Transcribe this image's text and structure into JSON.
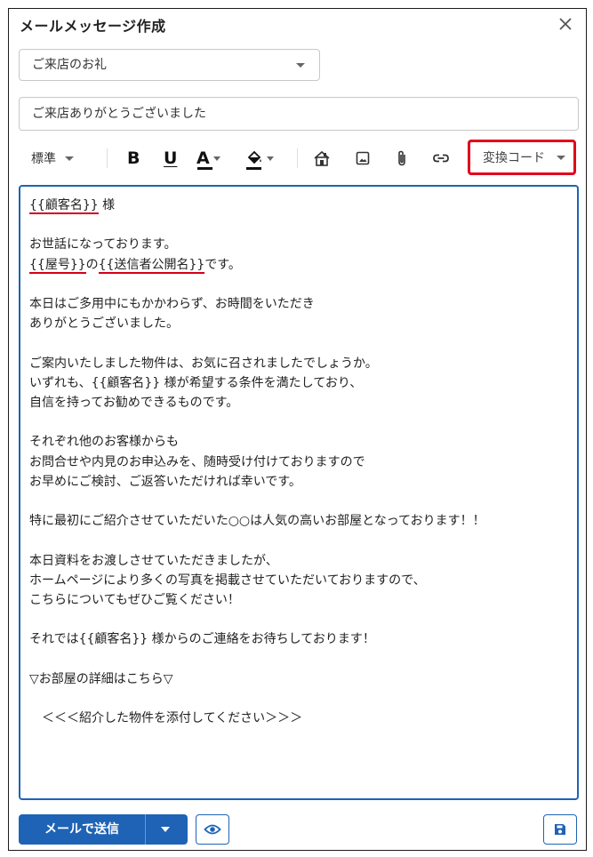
{
  "dialog": {
    "title": "メールメッセージ作成"
  },
  "template": {
    "selected": "ご来店のお礼"
  },
  "subject": {
    "value": "ご来店ありがとうございました"
  },
  "toolbar": {
    "style_label": "標準",
    "bold_label": "B",
    "underline_label": "U",
    "font_color_label": "A",
    "code_label": "変換コード"
  },
  "body": {
    "lines": [
      [
        "{{顧客名}}",
        " 様"
      ],
      [
        ""
      ],
      [
        "お世話になっております。"
      ],
      [
        "{{屋号}}",
        "の",
        "{{送信者公開名}}",
        "です。"
      ],
      [
        ""
      ],
      [
        "本日はご多用中にもかかわらず、お時間をいただき"
      ],
      [
        "ありがとうございました。"
      ],
      [
        ""
      ],
      [
        "ご案内いたしました物件は、お気に召されましたでしょうか。"
      ],
      [
        "いずれも、{{顧客名}} 様が希望する条件を満たしており、"
      ],
      [
        "自信を持ってお勧めできるものです。"
      ],
      [
        ""
      ],
      [
        "それぞれ他のお客様からも"
      ],
      [
        "お問合せや内見のお申込みを、随時受け付けておりますので"
      ],
      [
        "お早めにご検討、ご返答いただければ幸いです。"
      ],
      [
        ""
      ],
      [
        "特に最初にご紹介させていただいた○○は人気の高いお部屋となっております！！"
      ],
      [
        ""
      ],
      [
        "本日資料をお渡しさせていただきましたが、"
      ],
      [
        "ホームページにより多くの写真を掲載させていただいておりますので、"
      ],
      [
        "こちらについてもぜひご覧ください！"
      ],
      [
        ""
      ],
      [
        "それでは{{顧客名}} 様からのご連絡をお待ちしております！"
      ],
      [
        ""
      ],
      [
        "▽お部屋の詳細はこちら▽"
      ],
      [
        ""
      ],
      [
        "　＜＜＜紹介した物件を添付してください＞＞＞"
      ]
    ]
  },
  "footer": {
    "send_label": "メールで送信"
  },
  "colors": {
    "primary": "#1e63b6",
    "highlight_border": "#e0001b",
    "underline_mark": "#d4001a"
  },
  "icons": [
    "close-icon",
    "chevron-down-icon",
    "bold-icon",
    "underline-icon",
    "font-color-icon",
    "fill-color-icon",
    "house-icon",
    "image-icon",
    "paperclip-icon",
    "link-icon",
    "eye-icon",
    "save-icon"
  ]
}
